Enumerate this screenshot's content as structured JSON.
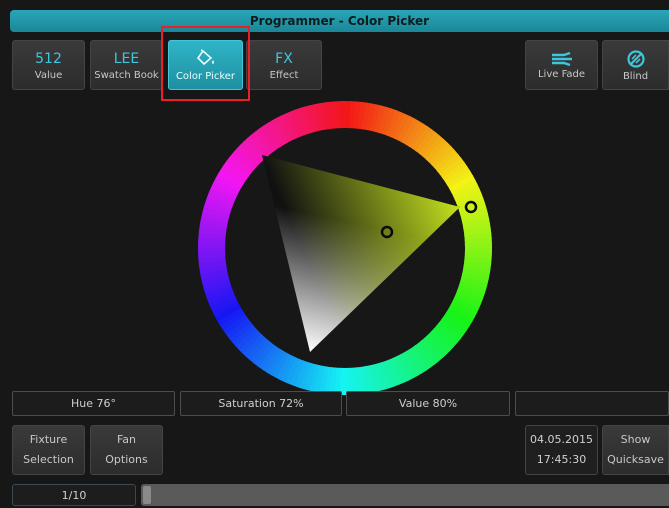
{
  "window": {
    "title": "Programmer - Color Picker"
  },
  "toolbar": {
    "value": {
      "big": "512",
      "label": "Value"
    },
    "swatch": {
      "big": "LEE",
      "label": "Swatch Book"
    },
    "picker": {
      "label": "Color Picker",
      "icon": "paint-bucket-icon"
    },
    "effect": {
      "big": "FX",
      "label": "Effect"
    },
    "live_fade": {
      "label": "Live Fade",
      "icon": "live-fade-icon"
    },
    "blind": {
      "label": "Blind",
      "icon": "blind-icon"
    }
  },
  "picker": {
    "hue": 76,
    "saturation": 72,
    "value": 80
  },
  "status": {
    "hue": "Hue 76°",
    "saturation": "Saturation 72%",
    "value": "Value 80%",
    "empty": ""
  },
  "bottom": {
    "fixture": [
      "Fixture",
      "Selection"
    ],
    "fan": [
      "Fan",
      "Options"
    ],
    "date": "04.05.2015",
    "time": "17:45:30",
    "show": [
      "Show",
      "Quicksave"
    ]
  },
  "pager": {
    "label": "1/10"
  },
  "colors": {
    "accent": "#2aa6b8",
    "highlight": "#e8202a"
  }
}
